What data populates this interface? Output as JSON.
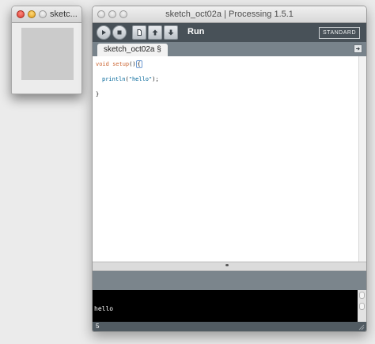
{
  "sketch_window": {
    "title": "sketc..."
  },
  "main_window": {
    "title": "sketch_oct02a | Processing 1.5.1",
    "toolbar": {
      "buttons": [
        "run",
        "stop",
        "new",
        "open",
        "save",
        "export"
      ],
      "hover_label": "Run",
      "mode_label": "STANDARD"
    },
    "tab": {
      "label": "sketch_oct02a §"
    },
    "editor": {
      "line1_keyword": "void",
      "line1_function": "setup",
      "line1_parens": "()",
      "line1_brace": "{",
      "line3_function": "println",
      "line3_open": "(",
      "line3_string": "\"hello\"",
      "line3_close": ");",
      "line5_brace": "}"
    },
    "console": {
      "output": "hello"
    },
    "status": {
      "line_number": "5"
    }
  }
}
